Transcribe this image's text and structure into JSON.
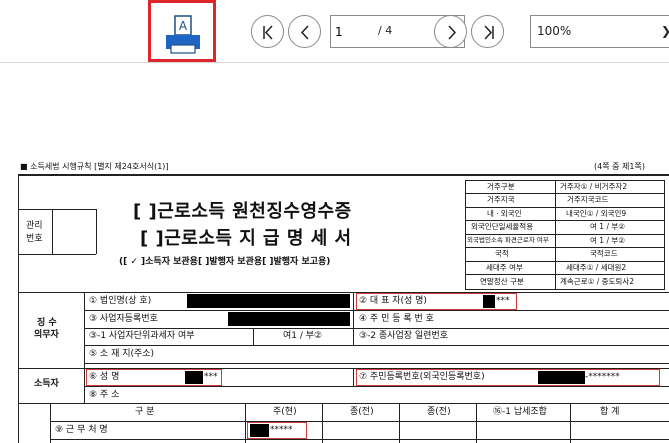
{
  "toolbar": {
    "print_letter": "A",
    "page_current": "1",
    "page_total": "/ 4",
    "zoom": "100%"
  },
  "doc": {
    "header_left": "■ 소득세법 시행규칙 [별지 제24호서식(1)]",
    "header_right": "(4쪽 중 제1쪽)",
    "mgmt_label_1": "관리",
    "mgmt_label_2": "번호",
    "title_1": "[  ]근로소득 원천징수영수증",
    "title_2": "[  ]근로소득 지 급 명 세 서",
    "subtitle": "([ ✓ ]소득자 보관용[        ]발행자 보관용[        ]발행자 보고용)",
    "right_table": [
      [
        "거주구분",
        "거주자① / 비거주자2"
      ],
      [
        "거주지국",
        "거주지국코드"
      ],
      [
        "내ㆍ외국인",
        "내국인① / 외국인9"
      ],
      [
        "외국인단일세율적용",
        "여 1 / 부②"
      ],
      [
        "외국법인소속 파견근로자 여부",
        "여 1 / 부②"
      ],
      [
        "국적",
        "국적코드"
      ],
      [
        "세대주 여부",
        "세대주① / 세대원2"
      ],
      [
        "연말정산 구분",
        "계속근로① / 중도퇴사2"
      ]
    ],
    "section_1": "징 수\n의무자",
    "section_1_a": "징 수",
    "section_1_b": "의무자",
    "section_2": "소득자",
    "row_1_a": "① 법인명(상 호)",
    "row_1_b": "② 대 표 자(성   명)",
    "row_1_b_mask": "***",
    "row_2_a": "③ 사업자등록번호",
    "row_2_b": "④ 주 민 등 록 번 호",
    "row_3_a": "③-1 사업자단위과세자 여부",
    "row_3_a_val": "여1 / 부②",
    "row_3_b": "③-2 종사업장 일련번호",
    "row_4_a": "⑤ 소 재 지(주소)",
    "row_5_a": "⑥ 성       명",
    "row_5_a_mask": "***",
    "row_5_b": "⑦ 주민등록번호(외국인등록번호)",
    "row_5_b_mask": "-*******",
    "row_6_a": "⑧ 주       소",
    "col_headers": [
      "구   분",
      "주(현)",
      "종(전)",
      "종(전)",
      "⑯-1 납세조합",
      "합   계"
    ],
    "row_7_a": "⑨ 근 무 처 명",
    "row_7_mask": "*****"
  }
}
